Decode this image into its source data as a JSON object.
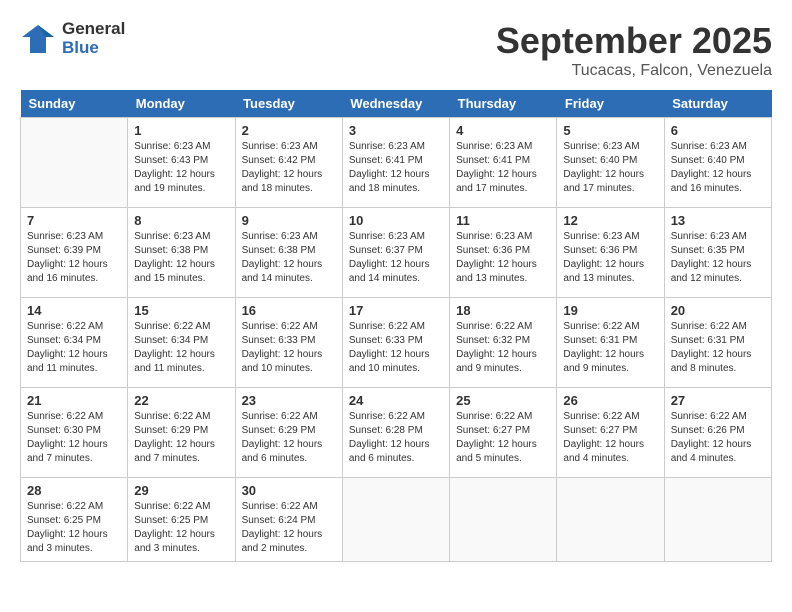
{
  "logo": {
    "line1": "General",
    "line2": "Blue"
  },
  "title": "September 2025",
  "subtitle": "Tucacas, Falcon, Venezuela",
  "days_of_week": [
    "Sunday",
    "Monday",
    "Tuesday",
    "Wednesday",
    "Thursday",
    "Friday",
    "Saturday"
  ],
  "weeks": [
    [
      {
        "day": "",
        "info": ""
      },
      {
        "day": "1",
        "info": "Sunrise: 6:23 AM\nSunset: 6:43 PM\nDaylight: 12 hours\nand 19 minutes."
      },
      {
        "day": "2",
        "info": "Sunrise: 6:23 AM\nSunset: 6:42 PM\nDaylight: 12 hours\nand 18 minutes."
      },
      {
        "day": "3",
        "info": "Sunrise: 6:23 AM\nSunset: 6:41 PM\nDaylight: 12 hours\nand 18 minutes."
      },
      {
        "day": "4",
        "info": "Sunrise: 6:23 AM\nSunset: 6:41 PM\nDaylight: 12 hours\nand 17 minutes."
      },
      {
        "day": "5",
        "info": "Sunrise: 6:23 AM\nSunset: 6:40 PM\nDaylight: 12 hours\nand 17 minutes."
      },
      {
        "day": "6",
        "info": "Sunrise: 6:23 AM\nSunset: 6:40 PM\nDaylight: 12 hours\nand 16 minutes."
      }
    ],
    [
      {
        "day": "7",
        "info": "Sunrise: 6:23 AM\nSunset: 6:39 PM\nDaylight: 12 hours\nand 16 minutes."
      },
      {
        "day": "8",
        "info": "Sunrise: 6:23 AM\nSunset: 6:38 PM\nDaylight: 12 hours\nand 15 minutes."
      },
      {
        "day": "9",
        "info": "Sunrise: 6:23 AM\nSunset: 6:38 PM\nDaylight: 12 hours\nand 14 minutes."
      },
      {
        "day": "10",
        "info": "Sunrise: 6:23 AM\nSunset: 6:37 PM\nDaylight: 12 hours\nand 14 minutes."
      },
      {
        "day": "11",
        "info": "Sunrise: 6:23 AM\nSunset: 6:36 PM\nDaylight: 12 hours\nand 13 minutes."
      },
      {
        "day": "12",
        "info": "Sunrise: 6:23 AM\nSunset: 6:36 PM\nDaylight: 12 hours\nand 13 minutes."
      },
      {
        "day": "13",
        "info": "Sunrise: 6:23 AM\nSunset: 6:35 PM\nDaylight: 12 hours\nand 12 minutes."
      }
    ],
    [
      {
        "day": "14",
        "info": "Sunrise: 6:22 AM\nSunset: 6:34 PM\nDaylight: 12 hours\nand 11 minutes."
      },
      {
        "day": "15",
        "info": "Sunrise: 6:22 AM\nSunset: 6:34 PM\nDaylight: 12 hours\nand 11 minutes."
      },
      {
        "day": "16",
        "info": "Sunrise: 6:22 AM\nSunset: 6:33 PM\nDaylight: 12 hours\nand 10 minutes."
      },
      {
        "day": "17",
        "info": "Sunrise: 6:22 AM\nSunset: 6:33 PM\nDaylight: 12 hours\nand 10 minutes."
      },
      {
        "day": "18",
        "info": "Sunrise: 6:22 AM\nSunset: 6:32 PM\nDaylight: 12 hours\nand 9 minutes."
      },
      {
        "day": "19",
        "info": "Sunrise: 6:22 AM\nSunset: 6:31 PM\nDaylight: 12 hours\nand 9 minutes."
      },
      {
        "day": "20",
        "info": "Sunrise: 6:22 AM\nSunset: 6:31 PM\nDaylight: 12 hours\nand 8 minutes."
      }
    ],
    [
      {
        "day": "21",
        "info": "Sunrise: 6:22 AM\nSunset: 6:30 PM\nDaylight: 12 hours\nand 7 minutes."
      },
      {
        "day": "22",
        "info": "Sunrise: 6:22 AM\nSunset: 6:29 PM\nDaylight: 12 hours\nand 7 minutes."
      },
      {
        "day": "23",
        "info": "Sunrise: 6:22 AM\nSunset: 6:29 PM\nDaylight: 12 hours\nand 6 minutes."
      },
      {
        "day": "24",
        "info": "Sunrise: 6:22 AM\nSunset: 6:28 PM\nDaylight: 12 hours\nand 6 minutes."
      },
      {
        "day": "25",
        "info": "Sunrise: 6:22 AM\nSunset: 6:27 PM\nDaylight: 12 hours\nand 5 minutes."
      },
      {
        "day": "26",
        "info": "Sunrise: 6:22 AM\nSunset: 6:27 PM\nDaylight: 12 hours\nand 4 minutes."
      },
      {
        "day": "27",
        "info": "Sunrise: 6:22 AM\nSunset: 6:26 PM\nDaylight: 12 hours\nand 4 minutes."
      }
    ],
    [
      {
        "day": "28",
        "info": "Sunrise: 6:22 AM\nSunset: 6:25 PM\nDaylight: 12 hours\nand 3 minutes."
      },
      {
        "day": "29",
        "info": "Sunrise: 6:22 AM\nSunset: 6:25 PM\nDaylight: 12 hours\nand 3 minutes."
      },
      {
        "day": "30",
        "info": "Sunrise: 6:22 AM\nSunset: 6:24 PM\nDaylight: 12 hours\nand 2 minutes."
      },
      {
        "day": "",
        "info": ""
      },
      {
        "day": "",
        "info": ""
      },
      {
        "day": "",
        "info": ""
      },
      {
        "day": "",
        "info": ""
      }
    ]
  ]
}
